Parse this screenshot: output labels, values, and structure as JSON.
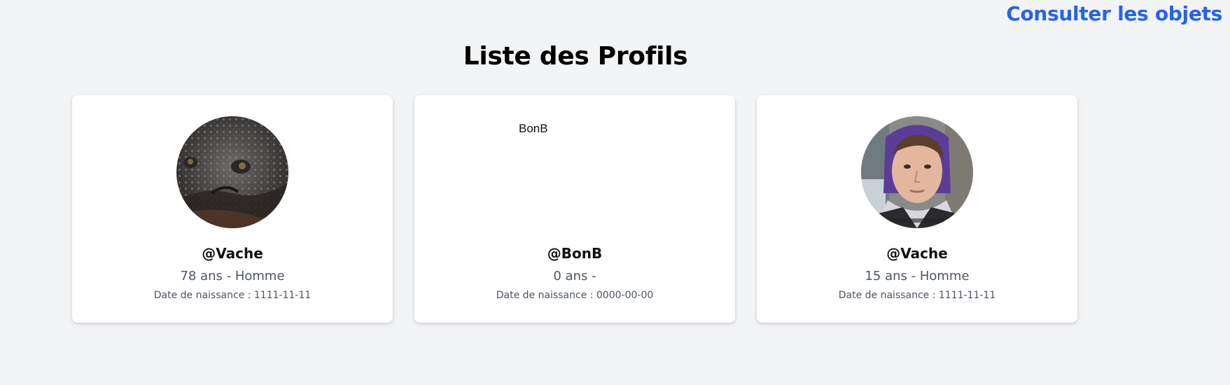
{
  "nav": {
    "link_label": "Consulter les objets",
    "link_color": "#2563eb"
  },
  "page": {
    "title": "Liste des Profils",
    "background": "#f3f4f6"
  },
  "profiles": [
    {
      "avatar": "toad-photo",
      "username": "@Vache",
      "age_sex": "78 ans - Homme",
      "dob": "Date de naissance : 1111-11-11"
    },
    {
      "avatar": "broken-image",
      "avatar_alt": "BonB",
      "username": "@BonB",
      "age_sex": "0 ans -",
      "dob": "Date de naissance : 0000-00-00"
    },
    {
      "avatar": "person-selfie-photo",
      "username": "@Vache",
      "age_sex": "15 ans - Homme",
      "dob": "Date de naissance : 1111-11-11"
    }
  ]
}
